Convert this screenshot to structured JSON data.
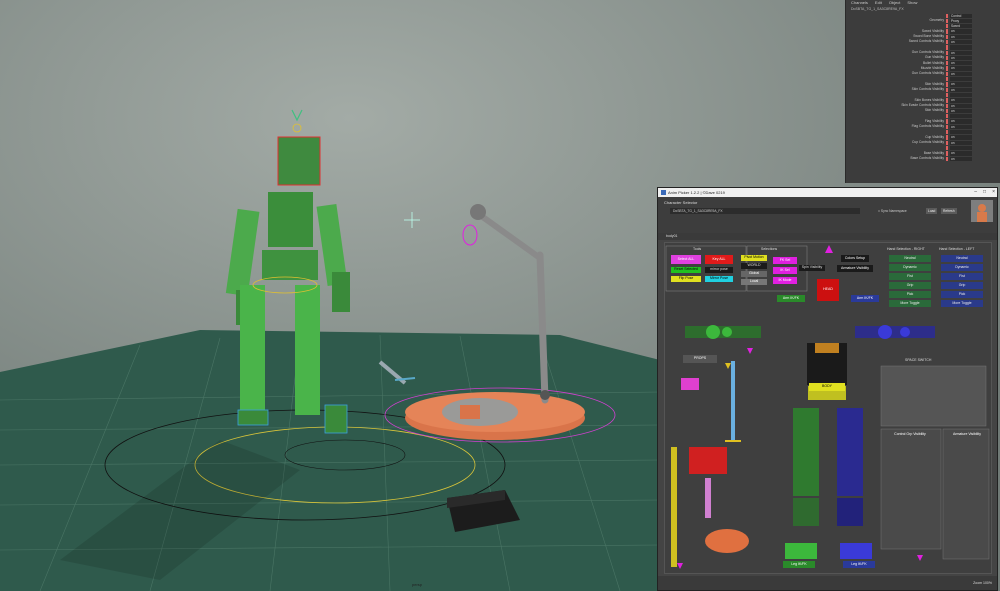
{
  "viewport": {
    "camera_label": "persp"
  },
  "channel_box": {
    "menu": [
      "Channels",
      "Edit",
      "Object",
      "Show"
    ],
    "object_name": "DoSBTA_TG_1_SA3C8RE9A_FX",
    "rows": [
      {
        "label": "",
        "value": "Control"
      },
      {
        "label": "Geometry",
        "value": "Proxy"
      },
      {
        "label": "",
        "value": "Sword"
      },
      {
        "label": "Sword Visibility",
        "value": "on"
      },
      {
        "label": "Sword Bone Visibility",
        "value": "on"
      },
      {
        "label": "Sword Controls Visibility",
        "value": "on"
      },
      {
        "label": "",
        "value": ""
      },
      {
        "label": "Gun Controls Visibility",
        "value": "on"
      },
      {
        "label": "Gun Visibility",
        "value": "on"
      },
      {
        "label": "Bullet Visibility",
        "value": "on"
      },
      {
        "label": "Muzzle Visibility",
        "value": "on"
      },
      {
        "label": "Gun Controls Visibility",
        "value": "on"
      },
      {
        "label": "",
        "value": ""
      },
      {
        "label": "Skin Visibility",
        "value": "on"
      },
      {
        "label": "Skin Controls Visibility",
        "value": "on"
      },
      {
        "label": "",
        "value": ""
      },
      {
        "label": "Skin Bones Visibility",
        "value": "on"
      },
      {
        "label": "Skin Evade Controls Visibility",
        "value": "on"
      },
      {
        "label": "Skin Visibility",
        "value": "on"
      },
      {
        "label": "",
        "value": ""
      },
      {
        "label": "Flag Visibility",
        "value": "on"
      },
      {
        "label": "Flag Controls Visibility",
        "value": "on"
      },
      {
        "label": "",
        "value": ""
      },
      {
        "label": "Cup Visibility",
        "value": "on"
      },
      {
        "label": "Cup Controls Visibility",
        "value": "on"
      },
      {
        "label": "",
        "value": ""
      },
      {
        "label": "Base Visibility",
        "value": "on"
      },
      {
        "label": "Base Controls Visibility",
        "value": "on"
      }
    ]
  },
  "picker": {
    "title": "Anim Picker 1.2.2 | ©Dave 0219",
    "character_selector": "Character Selector",
    "rig_name": "DoSBTA_TG_1_SA3C8RE9A_FX",
    "sync_label": "Sync Namespace",
    "btn_refresh": "Refresh",
    "btn_load": "Load",
    "tab": "body01",
    "zoom": "Zoom 100%"
  },
  "picker_buttons": [
    {
      "id": "tools",
      "text": "Tools"
    },
    {
      "id": "selections",
      "text": "Selections"
    },
    {
      "id": "select_all",
      "text": "Select ALL"
    },
    {
      "id": "key_all",
      "text": "Key ALL"
    },
    {
      "id": "reset_selected",
      "text": "Reset Selected"
    },
    {
      "id": "mirror_pose",
      "text": "mirror pose"
    },
    {
      "id": "flip_pose",
      "text": "Flip Pose"
    },
    {
      "id": "mirror_pose2",
      "text": "Mirror Pose"
    },
    {
      "id": "pivot_motion",
      "text": "Pivot Motion"
    },
    {
      "id": "world",
      "text": "WORLD"
    },
    {
      "id": "global",
      "text": "Global"
    },
    {
      "id": "local",
      "text": "Local"
    },
    {
      "id": "fk_select",
      "text": "FK Sel"
    },
    {
      "id": "ik_select",
      "text": "IK Sel"
    },
    {
      "id": "ik_mode",
      "text": "IK Mode"
    },
    {
      "id": "spin_visibility",
      "text": "Spin Visibility"
    },
    {
      "id": "colors_setup",
      "text": "Colors Setup"
    },
    {
      "id": "armature_visibility",
      "text": "Armature Visibility"
    },
    {
      "id": "hand_sel_right",
      "text": "Hand Selection - RIGHT"
    },
    {
      "id": "hand_sel_left",
      "text": "Hand Selection - LEFT"
    },
    {
      "id": "neutral_r",
      "text": "Neutral"
    },
    {
      "id": "dynamic_r",
      "text": "Dynamic"
    },
    {
      "id": "fist_r",
      "text": "Fist"
    },
    {
      "id": "grip_r",
      "text": "Grip"
    },
    {
      "id": "pick_r",
      "text": "Pick"
    },
    {
      "id": "more_toggle_r",
      "text": "More Toggle"
    },
    {
      "id": "neutral_l",
      "text": "Neutral"
    },
    {
      "id": "dynamic_l",
      "text": "Dynamic"
    },
    {
      "id": "fist_l",
      "text": "Fist"
    },
    {
      "id": "grip_l",
      "text": "Grip"
    },
    {
      "id": "pick_l",
      "text": "Pick"
    },
    {
      "id": "more_toggle_l",
      "text": "More Toggle"
    },
    {
      "id": "head",
      "text": "HEAD"
    },
    {
      "id": "arm_ikfk_r",
      "text": "Arm IK/FK"
    },
    {
      "id": "arm_ikfk_l",
      "text": "Arm IK/FK"
    },
    {
      "id": "props",
      "text": "PROPS"
    },
    {
      "id": "space_switch",
      "text": "SPACE SWITCH"
    },
    {
      "id": "body",
      "text": "BODY"
    },
    {
      "id": "control_grp_visibility",
      "text": "Control Grp Visibility"
    },
    {
      "id": "armature_visibility2",
      "text": "Armature Visibility"
    },
    {
      "id": "leg_ikfk_r",
      "text": "Leg IK/FK"
    },
    {
      "id": "leg_ikfk_l",
      "text": "Leg IK/FK"
    }
  ],
  "colors": {
    "limb_green": "#3cb83c",
    "limb_blue": "#3a3ad8",
    "torso_yellow": "#c0c020",
    "magenta": "#e020e0",
    "red": "#dd1010"
  }
}
